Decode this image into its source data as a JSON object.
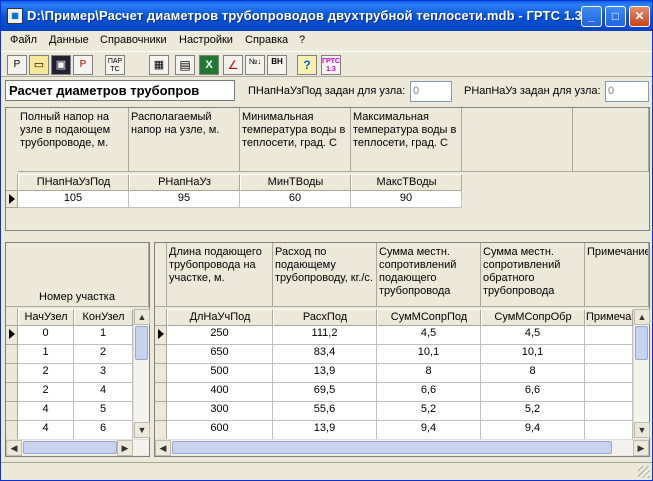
{
  "window": {
    "title": "D:\\Пример\\Расчет диаметров трубопроводов двухтрубной теплосети.mdb - ГРТС 1.3",
    "icon": "app-icon",
    "controls": {
      "minimize": "_",
      "maximize": "□",
      "close": "✕"
    }
  },
  "menu": [
    "Файл",
    "Данные",
    "Справочники",
    "Настройки",
    "Справка",
    "?"
  ],
  "toolbar": {
    "tools": [
      {
        "name": "print-preview-icon",
        "glyph": "P"
      },
      {
        "name": "open-icon",
        "glyph": "📂"
      },
      {
        "name": "save-icon",
        "glyph": "💾"
      },
      {
        "name": "print-icon",
        "glyph": "P"
      },
      {
        "name": "params-tc-icon",
        "glyph": "ПАР ТС"
      },
      {
        "name": "calculator-icon",
        "glyph": "▦"
      },
      {
        "name": "table-icon",
        "glyph": "▤"
      },
      {
        "name": "excel-icon",
        "glyph": "X"
      },
      {
        "name": "chart-icon",
        "glyph": "∠"
      },
      {
        "name": "sort-icon",
        "glyph": "№↓"
      },
      {
        "name": "order-icon",
        "glyph": "ВН"
      },
      {
        "name": "help-icon",
        "glyph": "?"
      },
      {
        "name": "grts-icon",
        "glyph": "ГРТС 1.3"
      }
    ]
  },
  "header": {
    "page_title": "Расчет диаметров трубопров",
    "supply_label": "ПНапНаУзПод задан для узла:",
    "supply_value": "0",
    "return_label": "РНапНаУз задан для узла:",
    "return_value": "0"
  },
  "top_grid": {
    "descriptions": [
      "Полный напор на узле в подающем трубопроводе, м.",
      "Располагаемый напор на узле, м.",
      "Минимальная температура воды в теплосети, град. С",
      "Максимальная температура воды в теплосети, град. С"
    ],
    "columns": [
      "ПНапНаУзПод",
      "РНапНаУз",
      "МинТВоды",
      "МаксТВоды"
    ],
    "rows": [
      [
        "105",
        "95",
        "60",
        "90"
      ]
    ]
  },
  "left_grid": {
    "group_header": "Номер участка",
    "columns": [
      "НачУзел",
      "КонУзел"
    ],
    "rows": [
      [
        "0",
        "1"
      ],
      [
        "1",
        "2"
      ],
      [
        "2",
        "3"
      ],
      [
        "2",
        "4"
      ],
      [
        "4",
        "5"
      ],
      [
        "4",
        "6"
      ]
    ]
  },
  "right_grid": {
    "descriptions": [
      "Длина подающего трубопровода на участке, м.",
      "Расход по подающему трубопроводу, кг./с.",
      "Сумма местн. сопротивлений подающего трубопровода",
      "Сумма местн. сопротивлений обратного трубопровода",
      "Примечание"
    ],
    "columns": [
      "ДлНаУчПод",
      "РасхПод",
      "СумМСопрПод",
      "СумМСопрОбр",
      "Примечан"
    ],
    "rows": [
      [
        "250",
        "111,2",
        "4,5",
        "4,5",
        ""
      ],
      [
        "650",
        "83,4",
        "10,1",
        "10,1",
        ""
      ],
      [
        "500",
        "13,9",
        "8",
        "8",
        ""
      ],
      [
        "400",
        "69,5",
        "6,6",
        "6,6",
        ""
      ],
      [
        "300",
        "55,6",
        "5,2",
        "5,2",
        ""
      ],
      [
        "600",
        "13,9",
        "9,4",
        "9,4",
        ""
      ]
    ]
  }
}
